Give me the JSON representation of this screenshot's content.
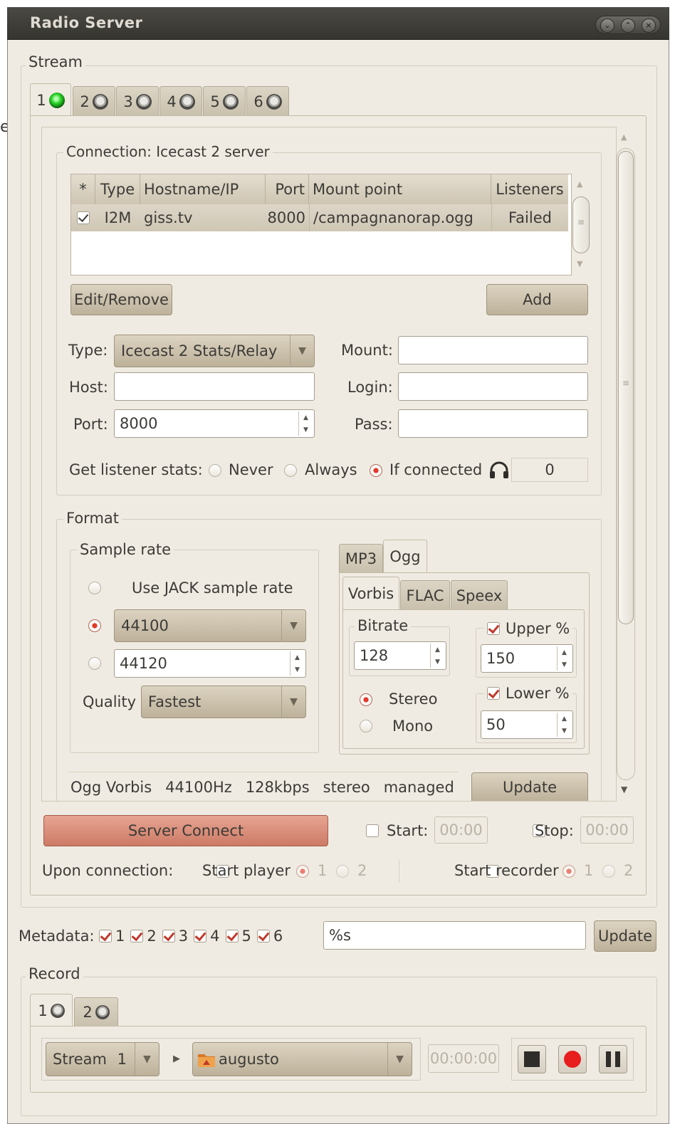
{
  "window": {
    "title": "Radio Server"
  },
  "stream": {
    "section_label": "Stream",
    "tabs": [
      {
        "label": "1",
        "active": true,
        "status": "on"
      },
      {
        "label": "2",
        "status": "off"
      },
      {
        "label": "3",
        "status": "off"
      },
      {
        "label": "4",
        "status": "off"
      },
      {
        "label": "5",
        "status": "off"
      },
      {
        "label": "6",
        "status": "off"
      }
    ],
    "connection": {
      "label": "Connection: Icecast 2 server",
      "columns": [
        "*",
        "Type",
        "Hostname/IP",
        "Port",
        "Mount point",
        "Listeners"
      ],
      "rows": [
        {
          "checked": true,
          "type": "I2M",
          "host": "giss.tv",
          "port": "8000",
          "mount": "/campagnanorap.ogg",
          "listeners": "Failed"
        }
      ],
      "edit_remove_label": "Edit/Remove",
      "add_label": "Add",
      "type_label": "Type:",
      "type_value": "Icecast 2 Stats/Relay",
      "mount_label": "Mount:",
      "mount_value": "",
      "host_label": "Host:",
      "host_value": "",
      "login_label": "Login:",
      "login_value": "",
      "port_label": "Port:",
      "port_value": "8000",
      "pass_label": "Pass:",
      "pass_value": "",
      "listener_stats_label": "Get listener stats:",
      "never_label": "Never",
      "always_label": "Always",
      "if_connected_label": "If connected",
      "selected_stats_option": "If connected",
      "listener_count": "0"
    },
    "format": {
      "label": "Format",
      "sample_rate_label": "Sample rate",
      "use_jack_label": "Use JACK sample rate",
      "rate_combo_value": "44100",
      "rate_custom_value": "44120",
      "selected_rate_option": "44100",
      "quality_label": "Quality",
      "quality_value": "Fastest",
      "codec_tabs": [
        "MP3",
        "Ogg"
      ],
      "active_codec_tab": "Ogg",
      "ogg_tabs": [
        "Vorbis",
        "FLAC",
        "Speex"
      ],
      "active_ogg_tab": "Vorbis",
      "bitrate_label": "Bitrate",
      "bitrate_value": "128",
      "upper_label": "Upper %",
      "upper_checked": true,
      "upper_value": "150",
      "lower_label": "Lower %",
      "lower_checked": true,
      "lower_value": "50",
      "stereo_label": "Stereo",
      "mono_label": "Mono",
      "selected_channels": "Stereo",
      "summary": {
        "codec": "Ogg Vorbis",
        "rate": "44100Hz",
        "bitrate": "128kbps",
        "channels": "stereo",
        "mode": "managed"
      },
      "update_label": "Update"
    },
    "server_connect_label": "Server Connect",
    "start_label": "Start:",
    "start_time": "00:00",
    "stop_label": "Stop:",
    "stop_time": "00:00",
    "upon_connection_label": "Upon connection:",
    "start_player_label": "Start player",
    "start_recorder_label": "Start recorder",
    "player_options": [
      "1",
      "2"
    ],
    "recorder_options": [
      "1",
      "2"
    ]
  },
  "metadata": {
    "label": "Metadata:",
    "checks": [
      {
        "label": "1",
        "checked": true
      },
      {
        "label": "2",
        "checked": true
      },
      {
        "label": "3",
        "checked": true
      },
      {
        "label": "4",
        "checked": true
      },
      {
        "label": "5",
        "checked": true
      },
      {
        "label": "6",
        "checked": true
      }
    ],
    "value": "%s",
    "update_label": "Update"
  },
  "record": {
    "section_label": "Record",
    "tabs": [
      {
        "label": "1",
        "active": true
      },
      {
        "label": "2"
      }
    ],
    "source_label": "Stream",
    "source_value": "1",
    "folder": "augusto",
    "time": "00:00:00"
  },
  "colors": {
    "accent_red": "#e23b2b",
    "led_green": "#2fd82f",
    "window_bg": "#f0ebe2",
    "titlebar": "#3c3b37"
  }
}
